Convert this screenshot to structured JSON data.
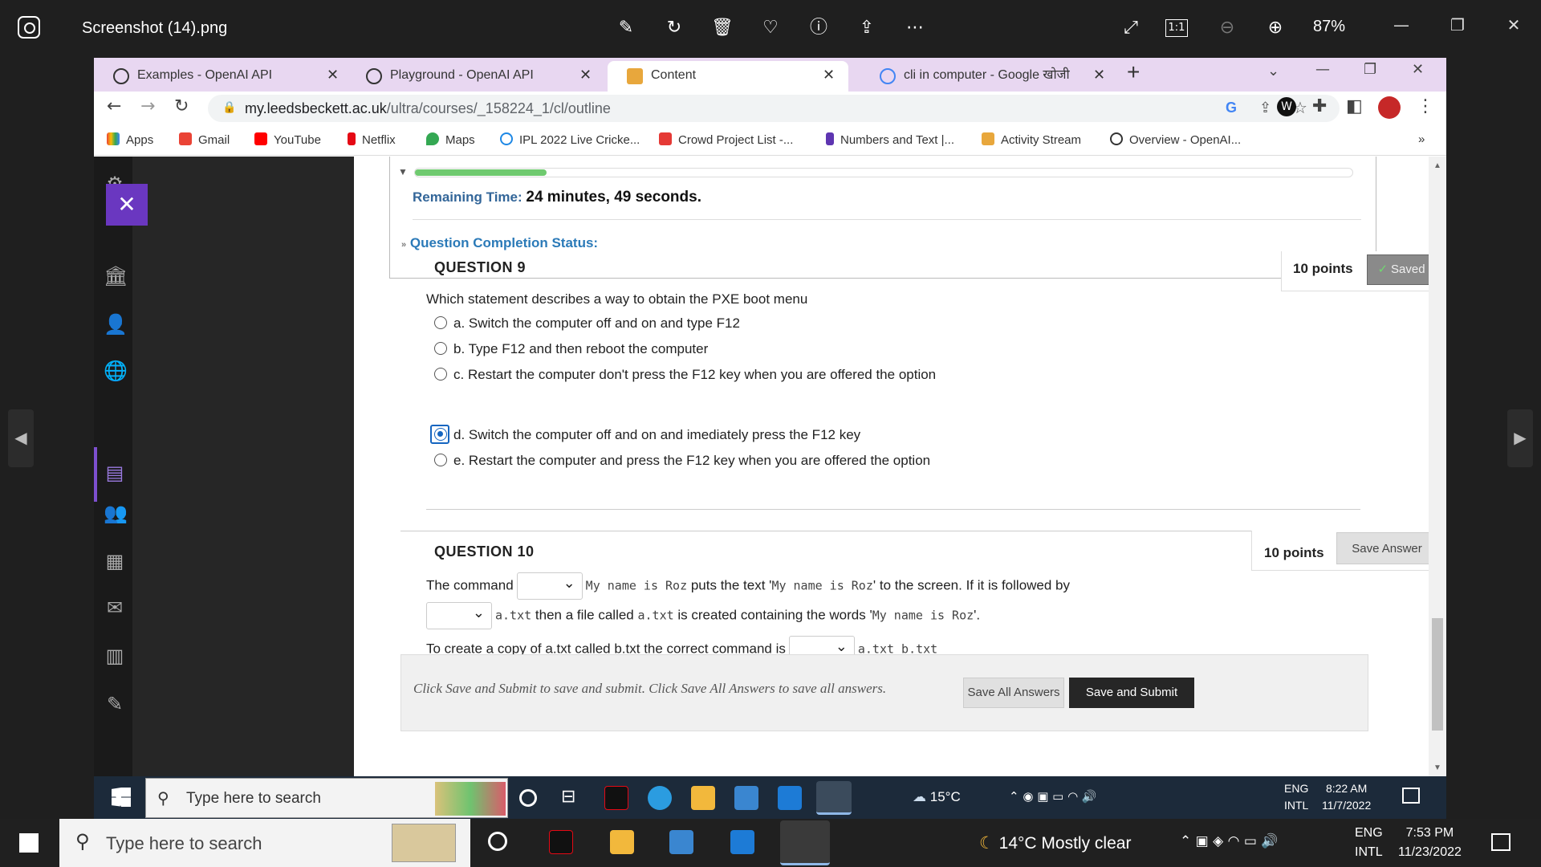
{
  "viewer": {
    "title": "Screenshot (14).png",
    "zoom": "87%",
    "tools": [
      "edit-icon",
      "rotate-icon",
      "delete-icon",
      "favorite-icon",
      "info-icon",
      "share-icon",
      "more-icon"
    ],
    "actual_size_label": "1:1"
  },
  "browser": {
    "tabs": [
      {
        "label": "Examples - OpenAI API",
        "active": false
      },
      {
        "label": "Playground - OpenAI API",
        "active": false
      },
      {
        "label": "Content",
        "active": true
      },
      {
        "label": "cli in computer - Google खोजी",
        "active": false
      }
    ],
    "url_host": "my.leedsbeckett.ac.uk",
    "url_path": "/ultra/courses/_158224_1/cl/outline",
    "bookmarks": [
      "Apps",
      "Gmail",
      "YouTube",
      "Netflix",
      "Maps",
      "IPL 2022 Live Cricke...",
      "Crowd Project List -...",
      "Numbers and Text |...",
      "Activity Stream",
      "Overview - OpenAI..."
    ],
    "bookmarks_more": "»"
  },
  "test": {
    "progress_fraction": 0.14,
    "remaining_label": "Remaining Time:",
    "remaining_value": "24 minutes, 49 seconds.",
    "completion_status_label": "Question Completion Status:",
    "q9": {
      "title": "QUESTION 9",
      "points": "10 points",
      "status": "Saved",
      "prompt": "Which statement describes a way to obtain the PXE boot menu",
      "options": [
        {
          "letter": "a.",
          "text": "Switch the computer off and on and type F12",
          "selected": false
        },
        {
          "letter": "b.",
          "text": "Type F12 and then reboot the computer",
          "selected": false
        },
        {
          "letter": "c.",
          "text": "Restart the computer don't press the F12 key when you are offered the option",
          "selected": false
        },
        {
          "letter": "d.",
          "text": "Switch the computer off and on and imediately press the F12 key",
          "selected": true
        },
        {
          "letter": "e.",
          "text": "Restart the computer and press the F12 key when you are offered the option",
          "selected": false
        }
      ]
    },
    "q10": {
      "title": "QUESTION 10",
      "points": "10 points",
      "save_label": "Save Answer",
      "l1_a": "The command",
      "l1_code": "My name is Roz",
      "l1_b": "puts the text '",
      "l1_code2": "My name is Roz",
      "l1_c": "' to the screen. If it is followed by",
      "l2_code": "a.txt",
      "l2_a": "then a file called",
      "l2_code2": "a.txt",
      "l2_b": "is created containing the words '",
      "l2_code3": "My name is Roz",
      "l2_c": "'.",
      "l3_a": "To create a copy of a.txt called b.txt the correct command is",
      "l3_code": "a.txt b.txt"
    },
    "footer_text": "Click Save and Submit to save and submit. Click Save All Answers to save all answers.",
    "save_all_label": "Save All Answers",
    "save_submit_label": "Save and Submit"
  },
  "inner_taskbar": {
    "search_placeholder": "Type here to search",
    "weather": "15°C",
    "lang1": "ENG",
    "lang2": "INTL",
    "time": "8:22 AM",
    "date": "11/7/2022"
  },
  "outer_taskbar": {
    "search_placeholder": "Type here to search",
    "weather": "14°C  Mostly clear",
    "lang1": "ENG",
    "lang2": "INTL",
    "time": "7:53 PM",
    "date": "11/23/2022"
  },
  "colors": {
    "accent_purple": "#6a37c0",
    "progress_green": "#6fca6f",
    "link_blue": "#2b7ab8",
    "selected_radio": "#1565c0"
  }
}
